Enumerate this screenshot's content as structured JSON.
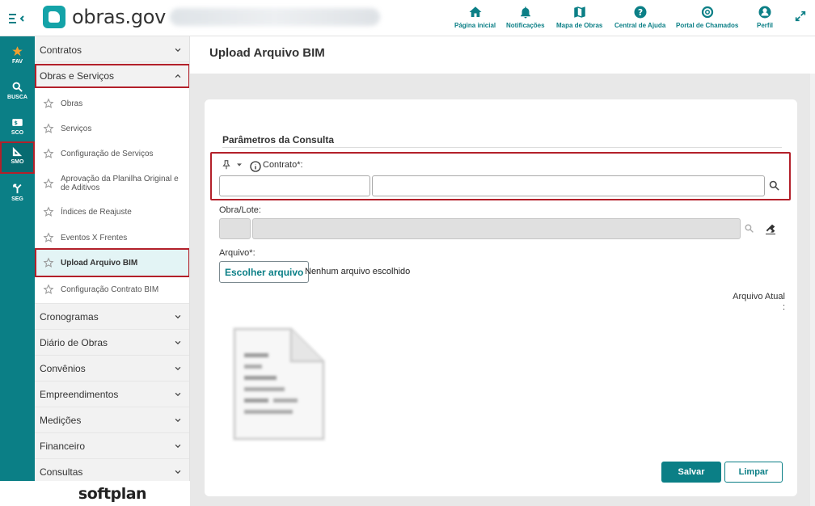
{
  "app": {
    "logo_text": "obras.gov"
  },
  "topnav": [
    {
      "label": "Página inicial",
      "icon": "home-icon"
    },
    {
      "label": "Notificações",
      "icon": "bell-icon"
    },
    {
      "label": "Mapa de Obras",
      "icon": "map-icon"
    },
    {
      "label": "Central de Ajuda",
      "icon": "help-icon"
    },
    {
      "label": "Portal de Chamados",
      "icon": "lifebuoy-icon"
    },
    {
      "label": "Perfil",
      "icon": "user-icon"
    }
  ],
  "rail": [
    {
      "label": "FAV",
      "icon": "star-icon"
    },
    {
      "label": "BUSCA",
      "icon": "search-icon"
    },
    {
      "label": "SCO",
      "icon": "money-icon"
    },
    {
      "label": "SMO",
      "icon": "ruler-icon"
    },
    {
      "label": "SEG",
      "icon": "merge-icon"
    }
  ],
  "sidebar": {
    "top_sections": [
      {
        "label": "Contratos"
      },
      {
        "label": "Obras e Serviços"
      }
    ],
    "sub_items": [
      {
        "label": "Obras"
      },
      {
        "label": "Serviços"
      },
      {
        "label": "Configuração de Serviços"
      },
      {
        "label": "Aprovação da Planilha Original e de Aditivos"
      },
      {
        "label": "Índices de Reajuste"
      },
      {
        "label": "Eventos X Frentes"
      },
      {
        "label": "Upload Arquivo BIM"
      },
      {
        "label": "Configuração Contrato BIM"
      }
    ],
    "bottom_sections": [
      {
        "label": "Cronogramas"
      },
      {
        "label": "Diário de Obras"
      },
      {
        "label": "Convênios"
      },
      {
        "label": "Empreendimentos"
      },
      {
        "label": "Medições"
      },
      {
        "label": "Financeiro"
      },
      {
        "label": "Consultas"
      }
    ],
    "footer_brand": "softplan"
  },
  "page": {
    "title": "Upload Arquivo BIM",
    "section_title": "Parâmetros da Consulta",
    "contrato_label": "Contrato*:",
    "contrato_code": "",
    "contrato_desc": "",
    "obra_label": "Obra/Lote:",
    "obra_code": "",
    "obra_desc": "",
    "arquivo_label": "Arquivo*:",
    "file_button": "Escolher arquivo",
    "file_status": "Nenhum arquivo escolhido",
    "arquivo_atual_label": "Arquivo Atual",
    "arquivo_atual_colon": ":",
    "save_label": "Salvar",
    "clear_label": "Limpar"
  }
}
